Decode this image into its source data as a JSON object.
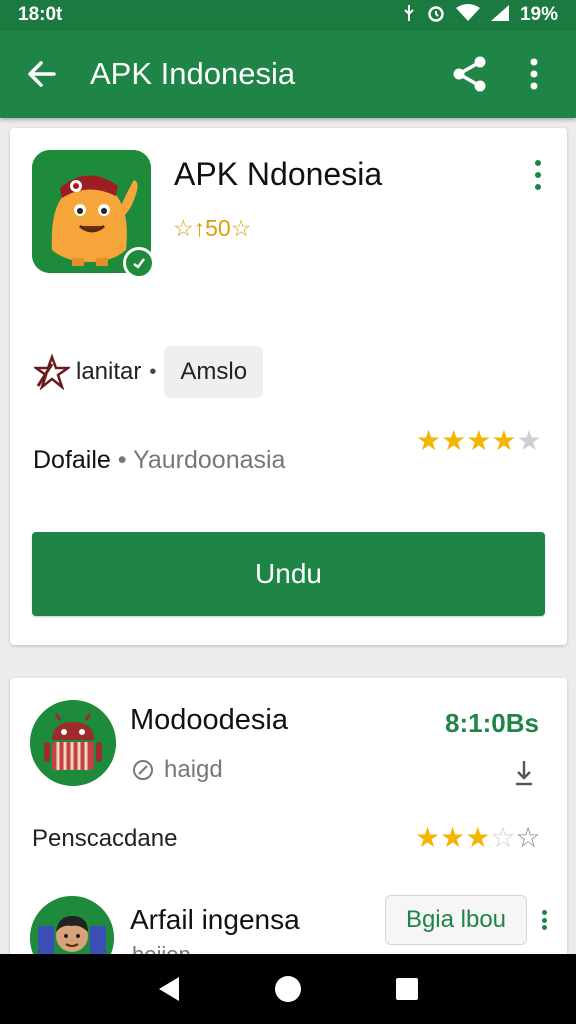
{
  "status": {
    "time": "18:0t",
    "battery": "19%",
    "icons": [
      "usb-icon",
      "alarm-icon",
      "wifi-icon",
      "signal-icon"
    ]
  },
  "appbar": {
    "title": "APK Indonesia",
    "icons": [
      "back-arrow-icon",
      "share-icon",
      "more-vert-icon"
    ]
  },
  "app": {
    "name": "APK Ndonesia",
    "rating_text": "☆↑50☆",
    "install_label": "lanitar",
    "install_chip": "Amslo",
    "details_label": "Dofaile",
    "details_value": "Yaurdoonasia",
    "rating_stars": 4,
    "install_button": "Undu"
  },
  "list": [
    {
      "title": "Modoodesia",
      "size": "8:1:0Bs",
      "sub": "haigd",
      "desc": "Penscacdane",
      "rating_stars": 3
    },
    {
      "title": "Arfail ingensa",
      "sub": "hoijon",
      "chip": "Bgia lbou"
    }
  ],
  "colors": {
    "primary": "#1e8546",
    "star": "#f2b500"
  },
  "navbar": {
    "icons": [
      "back-triangle-icon",
      "home-circle-icon",
      "recents-square-icon"
    ]
  }
}
